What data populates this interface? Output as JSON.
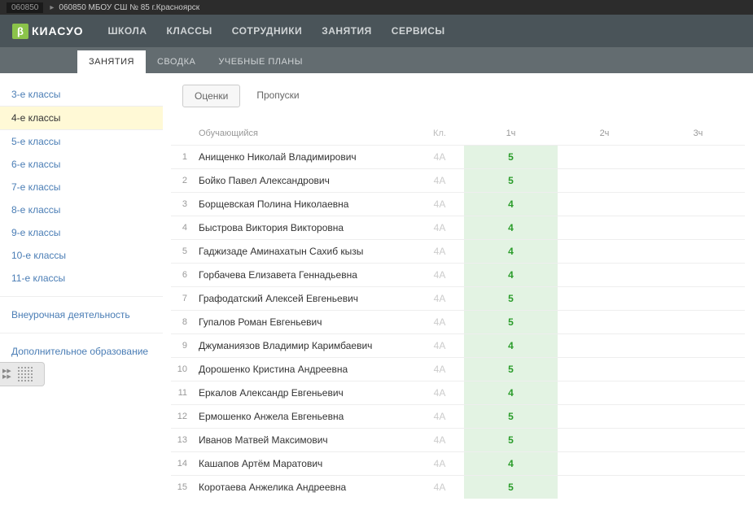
{
  "topbar": {
    "code": "060850",
    "title": "060850 МБОУ СШ № 85 г.Красноярск"
  },
  "logo": {
    "badge": "β",
    "text": "КИАСУО"
  },
  "mainNav": [
    "ШКОЛА",
    "КЛАССЫ",
    "СОТРУДНИКИ",
    "ЗАНЯТИЯ",
    "СЕРВИСЫ"
  ],
  "subNav": {
    "items": [
      "ЗАНЯТИЯ",
      "СВОДКА",
      "УЧЕБНЫЕ ПЛАНЫ"
    ],
    "active": 0
  },
  "sidebar": {
    "grades": [
      "3-е классы",
      "4-е классы",
      "5-е классы",
      "6-е классы",
      "7-е классы",
      "8-е классы",
      "9-е классы",
      "10-е классы",
      "11-е классы"
    ],
    "active": 1,
    "extra": [
      "Внеурочная деятельность",
      "Дополнительное образование"
    ]
  },
  "viewTabs": {
    "items": [
      "Оценки",
      "Пропуски"
    ],
    "active": 0
  },
  "table": {
    "headers": {
      "name": "Обучающийся",
      "class": "Кл.",
      "h1": "1ч",
      "h2": "2ч",
      "h3": "3ч"
    },
    "rows": [
      {
        "n": "1",
        "name": "Анищенко Николай Владимирович",
        "class": "4А",
        "g1": "5"
      },
      {
        "n": "2",
        "name": "Бойко Павел Александрович",
        "class": "4А",
        "g1": "5"
      },
      {
        "n": "3",
        "name": "Борщевская Полина Николаевна",
        "class": "4А",
        "g1": "4"
      },
      {
        "n": "4",
        "name": "Быстрова Виктория Викторовна",
        "class": "4А",
        "g1": "4"
      },
      {
        "n": "5",
        "name": "Гаджизаде Аминахатын Сахиб кызы",
        "class": "4А",
        "g1": "4"
      },
      {
        "n": "6",
        "name": "Горбачева Елизавета Геннадьевна",
        "class": "4А",
        "g1": "4"
      },
      {
        "n": "7",
        "name": "Графодатский Алексей Евгеньевич",
        "class": "4А",
        "g1": "5"
      },
      {
        "n": "8",
        "name": "Гупалов Роман Евгеньевич",
        "class": "4А",
        "g1": "5"
      },
      {
        "n": "9",
        "name": "Джуманиязов Владимир Каримбаевич",
        "class": "4А",
        "g1": "4"
      },
      {
        "n": "10",
        "name": "Дорошенко Кристина Андреевна",
        "class": "4А",
        "g1": "5"
      },
      {
        "n": "11",
        "name": "Еркалов Александр Евгеньевич",
        "class": "4А",
        "g1": "4"
      },
      {
        "n": "12",
        "name": "Ермошенко Анжела Евгеньевна",
        "class": "4А",
        "g1": "5"
      },
      {
        "n": "13",
        "name": "Иванов Матвей Максимович",
        "class": "4А",
        "g1": "5"
      },
      {
        "n": "14",
        "name": "Кашапов Артём Маратович",
        "class": "4А",
        "g1": "4"
      },
      {
        "n": "15",
        "name": "Коротаева Анжелика Андреевна",
        "class": "4А",
        "g1": "5"
      }
    ]
  }
}
